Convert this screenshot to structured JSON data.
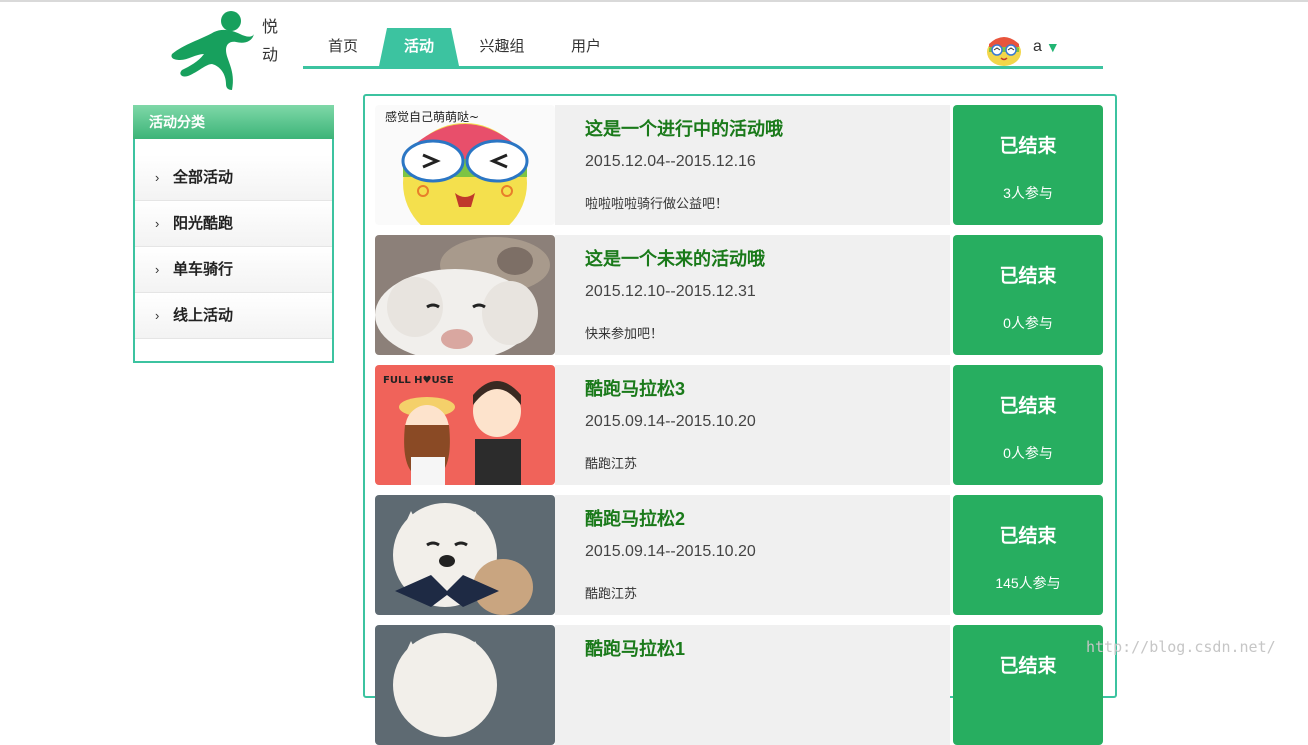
{
  "brand": {
    "line1": "悦",
    "line2": "动"
  },
  "nav": {
    "items": [
      {
        "label": "首页"
      },
      {
        "label": "活动"
      },
      {
        "label": "兴趣组"
      },
      {
        "label": "用户"
      }
    ],
    "active": "活动",
    "user": {
      "name": "a",
      "caret": "▼"
    }
  },
  "sidebar": {
    "title": "活动分类",
    "items": [
      {
        "label": "全部活动"
      },
      {
        "label": "阳光酷跑"
      },
      {
        "label": "单车骑行"
      },
      {
        "label": "线上活动"
      }
    ]
  },
  "activities": [
    {
      "title": "这是一个进行中的活动哦",
      "date": "2015.12.04--2015.12.16",
      "desc": "啦啦啦啦骑行做公益吧！",
      "status": "已结束",
      "participants": "3人参与",
      "image_caption": "感觉自己萌萌哒~"
    },
    {
      "title": "这是一个未来的活动哦",
      "date": "2015.12.10--2015.12.31",
      "desc": "快来参加吧！",
      "status": "已结束",
      "participants": "0人参与"
    },
    {
      "title": "酷跑马拉松3",
      "date": "2015.09.14--2015.10.20",
      "desc": "酷跑江苏",
      "status": "已结束",
      "participants": "0人参与",
      "image_caption": "FULL H♥USE"
    },
    {
      "title": "酷跑马拉松2",
      "date": "2015.09.14--2015.10.20",
      "desc": "酷跑江苏",
      "status": "已结束",
      "participants": "145人参与"
    },
    {
      "title": "酷跑马拉松1",
      "date": "",
      "desc": "",
      "status": "已结束",
      "participants": ""
    }
  ],
  "watermark": "http://blog.csdn.net/",
  "colors": {
    "accent": "#3cc3a0",
    "status_bg": "#27ae60",
    "title_green": "#1a7a1a"
  }
}
